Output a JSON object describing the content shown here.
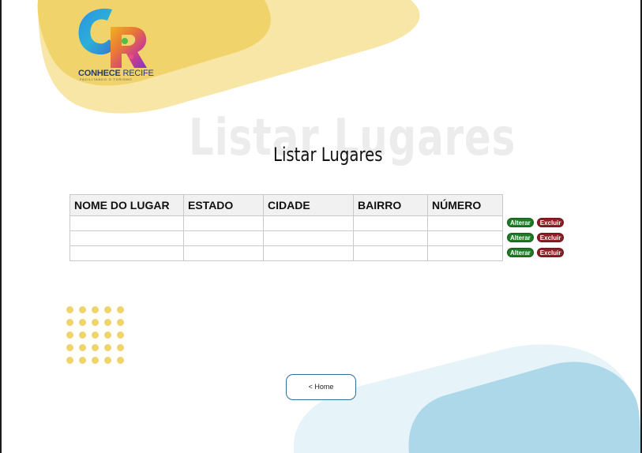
{
  "logo": {
    "brand_bold": "CONHECE",
    "brand_light": "RECIFE",
    "tagline": "FACILITANDO O TURISMO"
  },
  "page": {
    "title": "Listar Lugares",
    "title_ghost": "Listar Lugares"
  },
  "table": {
    "columns": [
      "NOME DO LUGAR",
      "ESTADO",
      "CIDADE",
      "BAIRRO",
      "NÚMERO"
    ],
    "rows": [
      [
        "",
        "",
        "",
        "",
        ""
      ],
      [
        "",
        "",
        "",
        "",
        ""
      ],
      [
        "",
        "",
        "",
        "",
        ""
      ]
    ]
  },
  "actions": {
    "edit_label": "Alterar",
    "delete_label": "Excluir"
  },
  "home_button": {
    "label": "< Home"
  },
  "colors": {
    "edit": "#1f7a26",
    "delete": "#8e1d24",
    "blob_yellow": "#f1d36b",
    "blob_yellow_light": "#f7e6a6",
    "blob_blue": "#add8ea",
    "blob_blue_light": "#e6f3f9"
  }
}
